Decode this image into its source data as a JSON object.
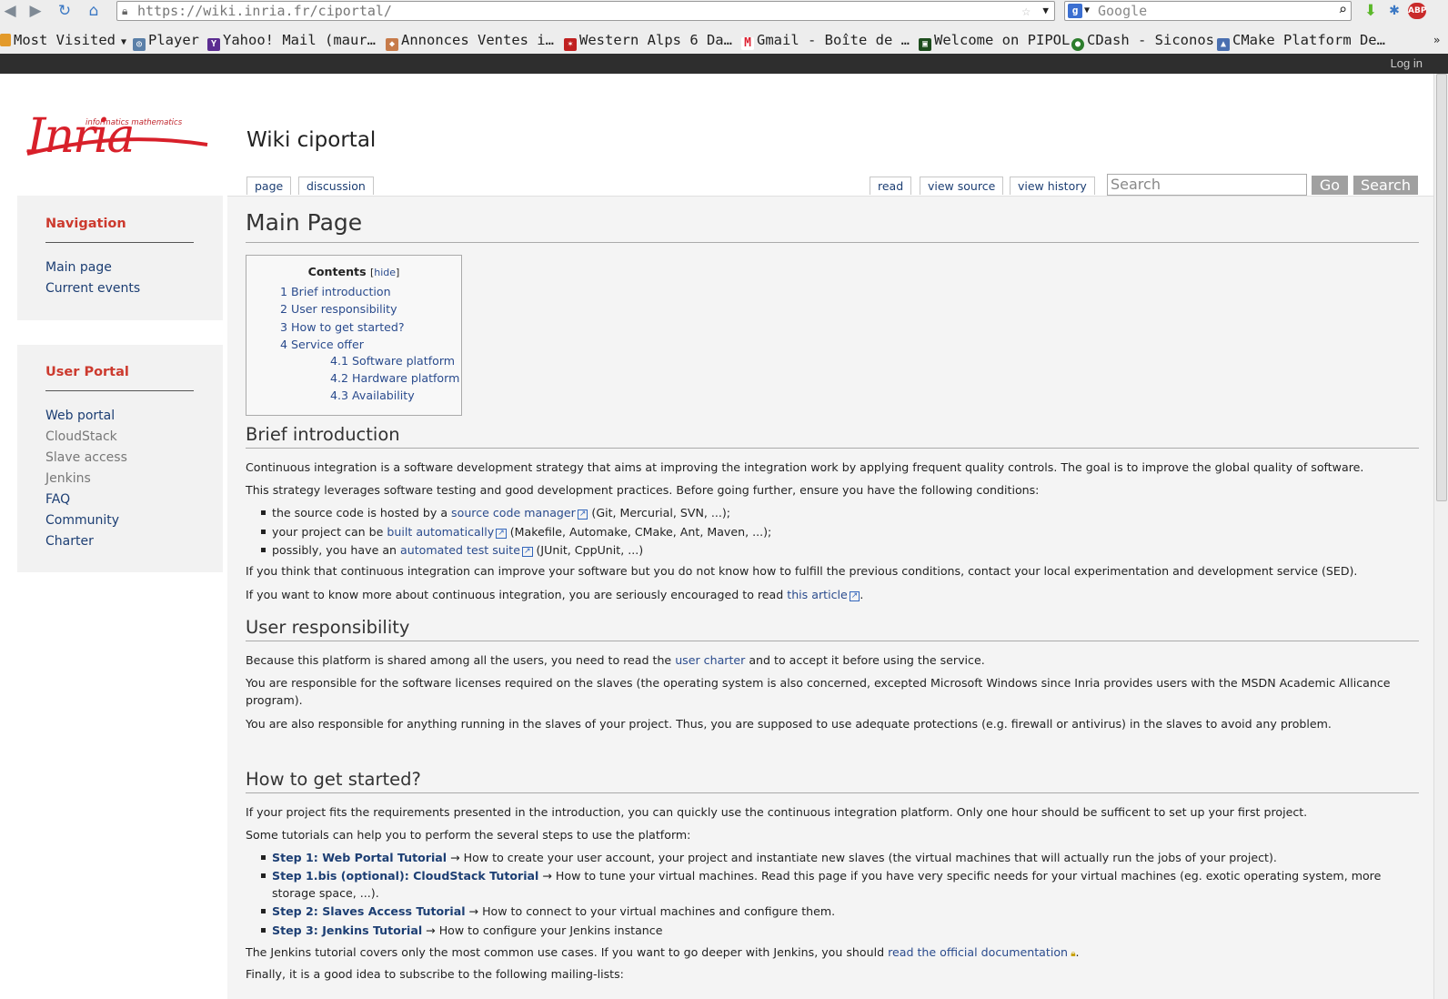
{
  "browser": {
    "url": "https://wiki.inria.fr/ciportal/",
    "search_engine_placeholder": "Google",
    "bookmarks": [
      "Most Visited",
      "Player",
      "Yahoo! Mail (maur…",
      "Annonces Ventes i…",
      "Western Alps 6 Da…",
      "Gmail - Boîte de …",
      "Welcome on PIPOL",
      "CDash - Siconos",
      "CMake Platform De…"
    ]
  },
  "topbar": {
    "login": "Log in"
  },
  "site": {
    "title": "Wiki ciportal",
    "tabs": [
      "page",
      "discussion"
    ],
    "actions": [
      "read",
      "view source",
      "view history"
    ],
    "search_placeholder": "Search",
    "go_button": "Go",
    "search_button": "Search"
  },
  "sidebar": {
    "navigation": {
      "title": "Navigation",
      "items": [
        "Main page",
        "Current events"
      ]
    },
    "user_portal": {
      "title": "User Portal",
      "items": [
        "Web portal",
        "CloudStack",
        "Slave access",
        "Jenkins",
        "FAQ",
        "Community",
        "Charter"
      ]
    }
  },
  "content": {
    "heading": "Main Page",
    "toc": {
      "title": "Contents",
      "hide": "hide",
      "items": [
        {
          "num": "1",
          "label": "Brief introduction"
        },
        {
          "num": "2",
          "label": "User responsibility"
        },
        {
          "num": "3",
          "label": "How to get started?"
        },
        {
          "num": "4",
          "label": "Service offer"
        },
        {
          "num": "4.1",
          "label": "Software platform"
        },
        {
          "num": "4.2",
          "label": "Hardware platform"
        },
        {
          "num": "4.3",
          "label": "Availability"
        }
      ]
    },
    "intro": {
      "heading": "Brief introduction",
      "p1": "Continuous integration is a software development strategy that aims at improving the integration work by applying frequent quality controls. The goal is to improve the global quality of software.",
      "p2": "This strategy leverages software testing and good development practices. Before going further, ensure you have the following conditions:",
      "li1_pre": "the source code is hosted by a ",
      "li1_link": "source code manager",
      "li1_post": " (Git, Mercurial, SVN, ...);",
      "li2_pre": "your project can be ",
      "li2_link": "built automatically",
      "li2_post": " (Makefile, Automake, CMake, Ant, Maven, ...);",
      "li3_pre": "possibly, you have an ",
      "li3_link": "automated test suite",
      "li3_post": " (JUnit, CppUnit, ...)",
      "p3": "If you think that continuous integration can improve your software but you do not know how to fulfill the previous conditions, contact your local experimentation and development service (SED).",
      "p4_pre": "If you want to know more about continuous integration, you are seriously encouraged to read ",
      "p4_link": "this article",
      "p4_post": "."
    },
    "responsibility": {
      "heading": "User responsibility",
      "p1_pre": "Because this platform is shared among all the users, you need to read the ",
      "p1_link": "user charter",
      "p1_post": " and to accept it before using the service.",
      "p2": "You are responsible for the software licenses required on the slaves (the operating system is also concerned, excepted Microsoft Windows since Inria provides users with the MSDN Academic Allicance program).",
      "p3": "You are also responsible for anything running in the slaves of your project. Thus, you are supposed to use adequate protections (e.g. firewall or antivirus) in the slaves to avoid any problem."
    },
    "started": {
      "heading": "How to get started?",
      "p1": "If your project fits the requirements presented in the introduction, you can quickly use the continuous integration platform. Only one hour should be sufficent to set up your first project.",
      "p2": "Some tutorials can help you to perform the several steps to use the platform:",
      "s1_link": "Step 1: Web Portal Tutorial",
      "s1_text": " → How to create your user account, your project and instantiate new slaves (the virtual machines that will actually run the jobs of your project).",
      "s2_link": "Step 1.bis (optional): CloudStack Tutorial",
      "s2_text": " → How to tune your virtual machines. Read this page if you have very specific needs for your virtual machines (eg. exotic operating system, more storage space, ...).",
      "s3_link": "Step 2: Slaves Access Tutorial",
      "s3_text": " → How to connect to your virtual machines and configure them.",
      "s4_link": "Step 3: Jenkins Tutorial",
      "s4_text": " → How to configure your Jenkins instance",
      "p3_pre": "The Jenkins tutorial covers only the most common use cases. If you want to go deeper with Jenkins, you should ",
      "p3_link": "read the official documentation",
      "p3_post": ".",
      "p4": "Finally, it is a good idea to subscribe to the following mailing-lists:"
    }
  },
  "colors": {
    "accent": "#cc3a2e",
    "link": "#2a4b8d",
    "topbar": "#2e2e2e"
  }
}
